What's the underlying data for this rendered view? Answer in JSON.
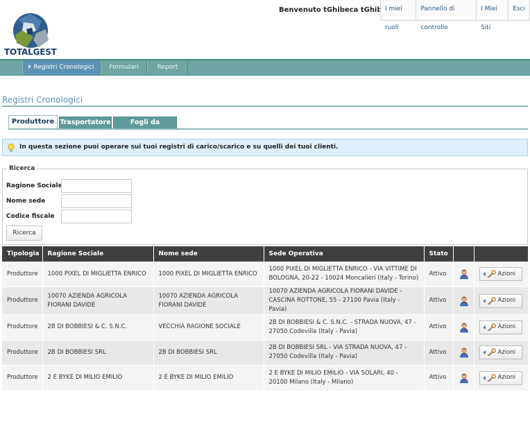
{
  "header": {
    "logo_text": "TOTALGEST",
    "welcome": "Benvenuto tGhibeca tGhibeca!",
    "links": [
      "I miei ruoli",
      "Pannello di controllo",
      "I Miei Siti",
      "Esci"
    ]
  },
  "nav": {
    "items": [
      {
        "label": "Registri Cronologici",
        "active": true
      },
      {
        "label": "Formulari",
        "active": false
      },
      {
        "label": "Report",
        "active": false
      }
    ]
  },
  "page": {
    "title": "Registri Cronologici"
  },
  "tabs": [
    {
      "label": "Produttore",
      "active": true
    },
    {
      "label": "Trasportatore",
      "active": false
    },
    {
      "label": "Fogli da vidimare",
      "active": false
    }
  ],
  "info": {
    "text": "In questa sezione puoi operare sui tuoi registri di carico/scarico e su quelli dei tuoi clienti."
  },
  "search": {
    "legend": "Ricerca",
    "fields": [
      {
        "label": "Ragione Sociale",
        "value": ""
      },
      {
        "label": "Nome sede",
        "value": ""
      },
      {
        "label": "Codice fiscale",
        "value": ""
      }
    ],
    "button": "Ricerca"
  },
  "table": {
    "columns": [
      "Tipologia",
      "Ragione Sociale",
      "Nome sede",
      "Sede Operativa",
      "Stato",
      "",
      ""
    ],
    "action_label": "Azioni",
    "rows": [
      {
        "tipologia": "Produttore",
        "ragione": "1000 PIXEL DI MIGLIETTA ENRICO",
        "sede": "1000 PIXEL DI MIGLIETTA ENRICO",
        "operativa": "1000 PIXEL DI MIGLIETTA ENRICO - VIA VITTIME DI BOLOGNA, 20-22 - 10024 Moncalieri (Italy - Torino)",
        "stato": "Attivo"
      },
      {
        "tipologia": "Produttore",
        "ragione": "10070 AZIENDA AGRICOLA FIORANI DAVIDE",
        "sede": "10070 AZIENDA AGRICOLA FIORANI DAVIDE",
        "operativa": "10070 AZIENDA AGRICOLA FIORANI DAVIDE - CASCINA ROTTONE, 55 - 27100 Pavia (Italy - Pavia)",
        "stato": "Attivo"
      },
      {
        "tipologia": "Produttore",
        "ragione": "2B DI BOBBIESI & C. S.N.C.",
        "sede": "VECCHIA RAGIONE SOCIALE",
        "operativa": "2B DI BOBBIESI & C. S.N.C. - STRADA NUOVA, 47 - 27050 Codevilla (Italy - Pavia)",
        "stato": "Attivo"
      },
      {
        "tipologia": "Produttore",
        "ragione": "2B DI BOBBIESI SRL",
        "sede": "2B DI BOBBIESI SRL",
        "operativa": "2B DI BOBBIESI SRL - VIA STRADA NUOVA, 47 - 27050 Codevilla (Italy - Pavia)",
        "stato": "Attivo"
      },
      {
        "tipologia": "Produttore",
        "ragione": "2 E BYKE DI MILIO EMILIO",
        "sede": "2 E BYKE DI MILIO EMILIO",
        "operativa": "2 E BYKE DI MILIO EMILIO - VIA SOLARI, 40 - 20100 Milano (Italy - Milano)",
        "stato": "Attivo"
      }
    ]
  }
}
